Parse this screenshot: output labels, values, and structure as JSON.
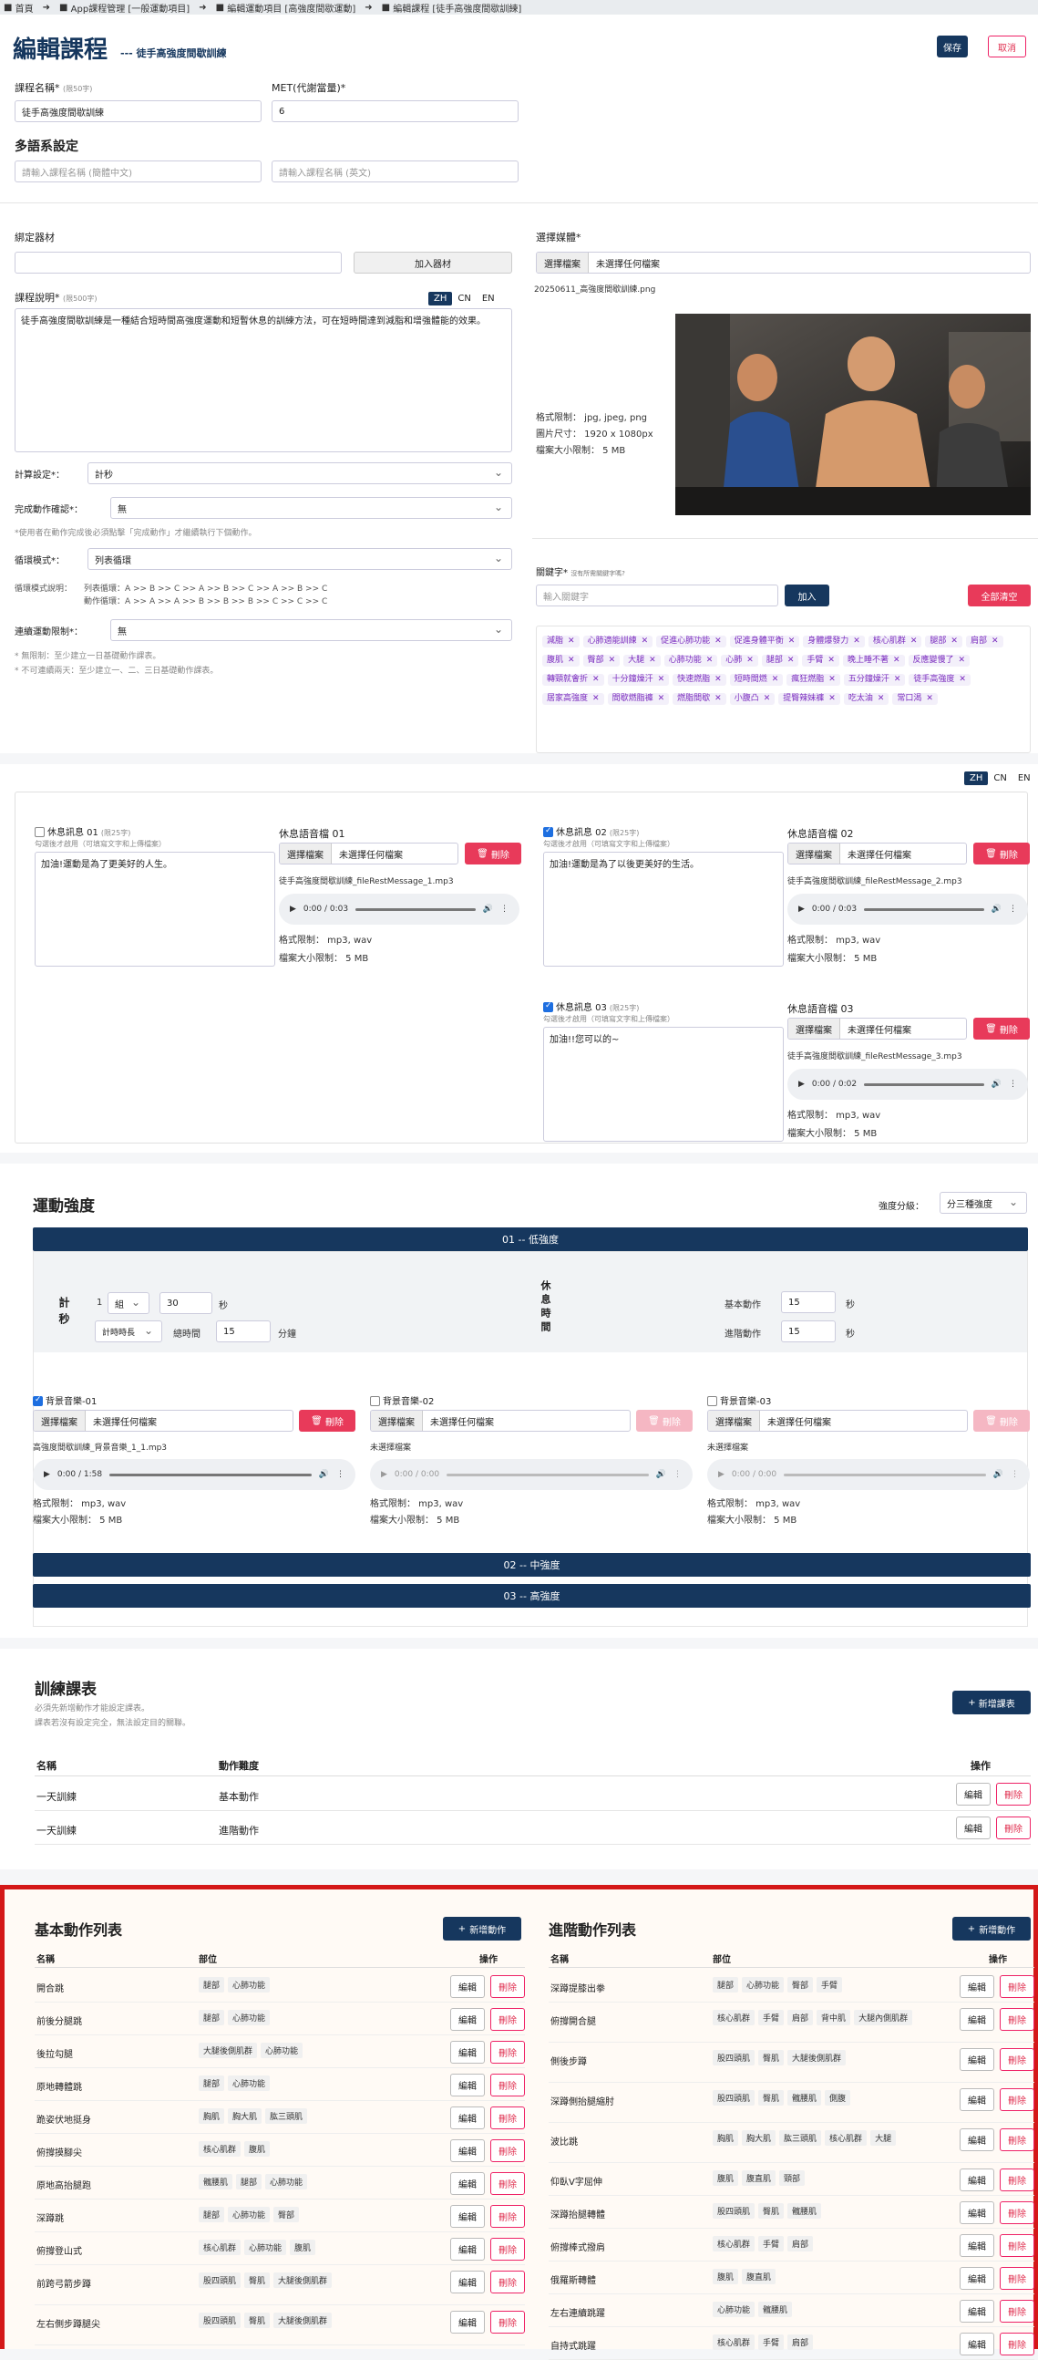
{
  "breadcrumb": [
    "首頁",
    "App課程管理 [一般運動項目]",
    "編輯運動項目 [高強度間歇運動]",
    "編輯課程 [徒手高強度間歇訓練]"
  ],
  "header": {
    "title": "編輯課程",
    "subtitle": "--- 徒手高強度間歇訓練",
    "save": "保存",
    "cancel": "取消"
  },
  "form": {
    "name_label": "課程名稱*",
    "name_hint": "(限50字)",
    "name_value": "徒手高強度間歇訓練",
    "met_label": "MET(代謝當量)*",
    "met_value": "6",
    "multilang_title": "多語系設定",
    "ml_ph_cn": "請輸入課程名稱 (簡體中文)",
    "ml_ph_en": "請輸入課程名稱 (英文)",
    "equip_label": "綁定器材",
    "equip_add": "加入器材",
    "desc_label": "課程說明*",
    "desc_hint": "(限500字)",
    "desc_value": "徒手高強度間歇訓練是一種結合短時間高強度運動和短暫休息的訓練方法，可在短時間達到減脂和增強體能的效果。",
    "lang": [
      "ZH",
      "CN",
      "EN"
    ],
    "calc_label": "計算設定*：",
    "calc_value": "計秒",
    "confirm_label": "完成動作確認*：",
    "confirm_value": "無",
    "confirm_note": "*使用者在動作完成後必須點擊「完成動作」才繼續執行下個動作。",
    "loop_label": "循環模式*：",
    "loop_value": "列表循環",
    "loop_desc_label": "循環模式說明：",
    "loop_desc_1": "列表循環：A >> B >> C >> A >> B >> C >> A >> B >> C",
    "loop_desc_2": "動作循環：A >> A >> A >> B >> B >> B >> C >> C >> C",
    "days_label": "連續運動限制*：",
    "days_value": "無",
    "days_note1": "* 無限制：至少建立一日基礎動作課表。",
    "days_note2": "* 不可連續兩天：至少建立一、二、三日基礎動作課表。",
    "media_label": "選擇媒體*",
    "file_btn": "選擇檔案",
    "file_none": "未選擇任何檔案",
    "media_file": "20250611_高強度間歇訓練.png",
    "img_fmt": "格式限制： jpg, jpeg, png",
    "img_size": "圖片尺寸： 1920 x 1080px",
    "img_max": "檔案大小限制： 5 MB",
    "kw_label": "關鍵字*",
    "kw_hint": "沒有所需關鍵字嗎?",
    "kw_ph": "輸入關鍵字",
    "kw_add": "加入",
    "kw_clear": "全部清空",
    "keywords": [
      "減脂",
      "心肺適能訓練",
      "促進心肺功能",
      "促進身體平衡",
      "身體爆發力",
      "核心肌群",
      "腿部",
      "肩部",
      "腹肌",
      "臀部",
      "大腿",
      "心肺功能",
      "心肺",
      "腿部",
      "手臂",
      "晚上睡不著",
      "反應變慢了",
      "轉頸就會折",
      "十分鐘燥汗",
      "快速燃脂",
      "短時間燃",
      "瘋狂燃脂",
      "五分鐘燥汗",
      "徒手高強度",
      "居家高強度",
      "間歇燃脂褲",
      "燃脂間歇",
      "小腹凸",
      "提臀辣妹褲",
      "吃太油",
      "常口渴"
    ]
  },
  "rest": {
    "lang": [
      "ZH",
      "CN",
      "EN"
    ],
    "msgs": [
      {
        "label": "休息訊息 01",
        "hint": "(限25字)",
        "sub": "勾選後才啟用（可填寫文字和上傳檔案）",
        "text": "加油!運動是為了更美好的人生。",
        "checked": false,
        "audio_label": "休息語音檔 01",
        "file": "徒手高強度間歇訓練_fileRestMessage_1.mp3",
        "time": "0:00 / 0:03"
      },
      {
        "label": "休息訊息 02",
        "hint": "(限25字)",
        "sub": "勾選後才啟用（可填寫文字和上傳檔案）",
        "text": "加油!運動是為了以後更美好的生活。",
        "checked": true,
        "audio_label": "休息語音檔 02",
        "file": "徒手高強度間歇訓練_fileRestMessage_2.mp3",
        "time": "0:00 / 0:03"
      },
      {
        "label": "休息訊息 03",
        "hint": "(限25字)",
        "sub": "勾選後才啟用（可填寫文字和上傳檔案）",
        "text": "加油!!您可以的~",
        "checked": true,
        "audio_label": "休息語音檔 03",
        "file": "徒手高強度間歇訓練_fileRestMessage_3.mp3",
        "time": "0:00 / 0:02"
      }
    ],
    "del": "刪除",
    "fmt": "格式限制： mp3, wav",
    "max": "檔案大小限制： 5 MB"
  },
  "intensity": {
    "title": "運動強度",
    "level_label": "強度分級：",
    "level_value": "分三種強度",
    "band1": "01 -- 低強度",
    "band2": "02 -- 中強度",
    "band3": "03 -- 高強度",
    "calc": "計秒",
    "set_n": "1",
    "set_unit": "組",
    "sec_val": "30",
    "sec": "秒",
    "mode": "計時時長",
    "total_label": "總時間",
    "total_val": "15",
    "minute": "分鐘",
    "rest_title": "休息時間",
    "basic": "基本動作",
    "basic_val": "15",
    "adv": "進階動作",
    "adv_val": "15",
    "bgm": [
      {
        "label": "背景音樂-01",
        "checked": true,
        "file": "高強度間歇訓練_背景音樂_1_1.mp3",
        "time": "0:00 / 1:58"
      },
      {
        "label": "背景音樂-02",
        "checked": false,
        "file": "未選擇檔案",
        "time": "0:00 / 0:00"
      },
      {
        "label": "背景音樂-03",
        "checked": false,
        "file": "未選擇檔案",
        "time": "0:00 / 0:00"
      }
    ]
  },
  "schedule": {
    "title": "訓練課表",
    "note1": "必須先新增動作才能設定課表。",
    "note2": "課表若沒有設定完全，無法設定目的關聯。",
    "add": "新增課表",
    "cols": [
      "名稱",
      "動作難度",
      "操作"
    ],
    "rows": [
      {
        "name": "一天訓練",
        "level": "基本動作"
      },
      {
        "name": "一天訓練",
        "level": "進階動作"
      }
    ],
    "edit": "編輯",
    "del": "刪除"
  },
  "basic_list": {
    "title": "基本動作列表",
    "add": "新增動作",
    "cols": [
      "名稱",
      "部位",
      "操作"
    ],
    "rows": [
      {
        "name": "開合跳",
        "parts": [
          "腿部",
          "心肺功能"
        ]
      },
      {
        "name": "前後分腿跳",
        "parts": [
          "腿部",
          "心肺功能"
        ]
      },
      {
        "name": "後拉勾腿",
        "parts": [
          "大腿後側肌群",
          "心肺功能"
        ]
      },
      {
        "name": "原地轉體跳",
        "parts": [
          "腿部",
          "心肺功能"
        ]
      },
      {
        "name": "跪姿伏地挺身",
        "parts": [
          "胸肌",
          "胸大肌",
          "肱三頭肌"
        ]
      },
      {
        "name": "俯撐摸腳尖",
        "parts": [
          "核心肌群",
          "腹肌"
        ]
      },
      {
        "name": "原地高抬腿跑",
        "parts": [
          "髖腰肌",
          "腿部",
          "心肺功能"
        ]
      },
      {
        "name": "深蹲跳",
        "parts": [
          "腿部",
          "心肺功能",
          "臀部"
        ]
      },
      {
        "name": "俯撐登山式",
        "parts": [
          "核心肌群",
          "心肺功能",
          "腹肌"
        ]
      },
      {
        "name": "前跨弓箭步蹲",
        "parts": [
          "股四頭肌",
          "臀肌",
          "大腿後側肌群"
        ]
      },
      {
        "name": "左右側步蹲腿尖",
        "parts": [
          "股四頭肌",
          "臀肌",
          "大腿後側肌群"
        ]
      }
    ]
  },
  "adv_list": {
    "title": "進階動作列表",
    "add": "新增動作",
    "cols": [
      "名稱",
      "部位",
      "操作"
    ],
    "rows": [
      {
        "name": "深蹲提膝出拳",
        "parts": [
          "腿部",
          "心肺功能",
          "臀部",
          "手臂"
        ]
      },
      {
        "name": "俯撐開合腿",
        "parts": [
          "核心肌群",
          "手臂",
          "肩部",
          "背中肌",
          "大腿內側肌群"
        ]
      },
      {
        "name": "側後步蹲",
        "parts": [
          "股四頭肌",
          "臀肌",
          "大腿後側肌群"
        ]
      },
      {
        "name": "深蹲側抬腿縮肘",
        "parts": [
          "股四頭肌",
          "臀肌",
          "髖腰肌",
          "側腹"
        ]
      },
      {
        "name": "波比跳",
        "parts": [
          "胸肌",
          "胸大肌",
          "肱三頭肌",
          "核心肌群",
          "大腿"
        ]
      },
      {
        "name": "仰臥V字屈伸",
        "parts": [
          "腹肌",
          "腹直肌",
          "頸部"
        ]
      },
      {
        "name": "深蹲抬腿轉體",
        "parts": [
          "股四頭肌",
          "臀肌",
          "髖腰肌"
        ]
      },
      {
        "name": "俯撐棒式撥肩",
        "parts": [
          "核心肌群",
          "手臂",
          "肩部"
        ]
      },
      {
        "name": "俄羅斯轉體",
        "parts": [
          "腹肌",
          "腹直肌"
        ]
      },
      {
        "name": "左右連續跳躍",
        "parts": [
          "心肺功能",
          "髖腰肌"
        ]
      },
      {
        "name": "自持式跳躍",
        "parts": [
          "核心肌群",
          "手臂",
          "肩部"
        ]
      }
    ]
  },
  "common": {
    "edit": "編輯",
    "del": "刪除",
    "add_icon": "+"
  }
}
